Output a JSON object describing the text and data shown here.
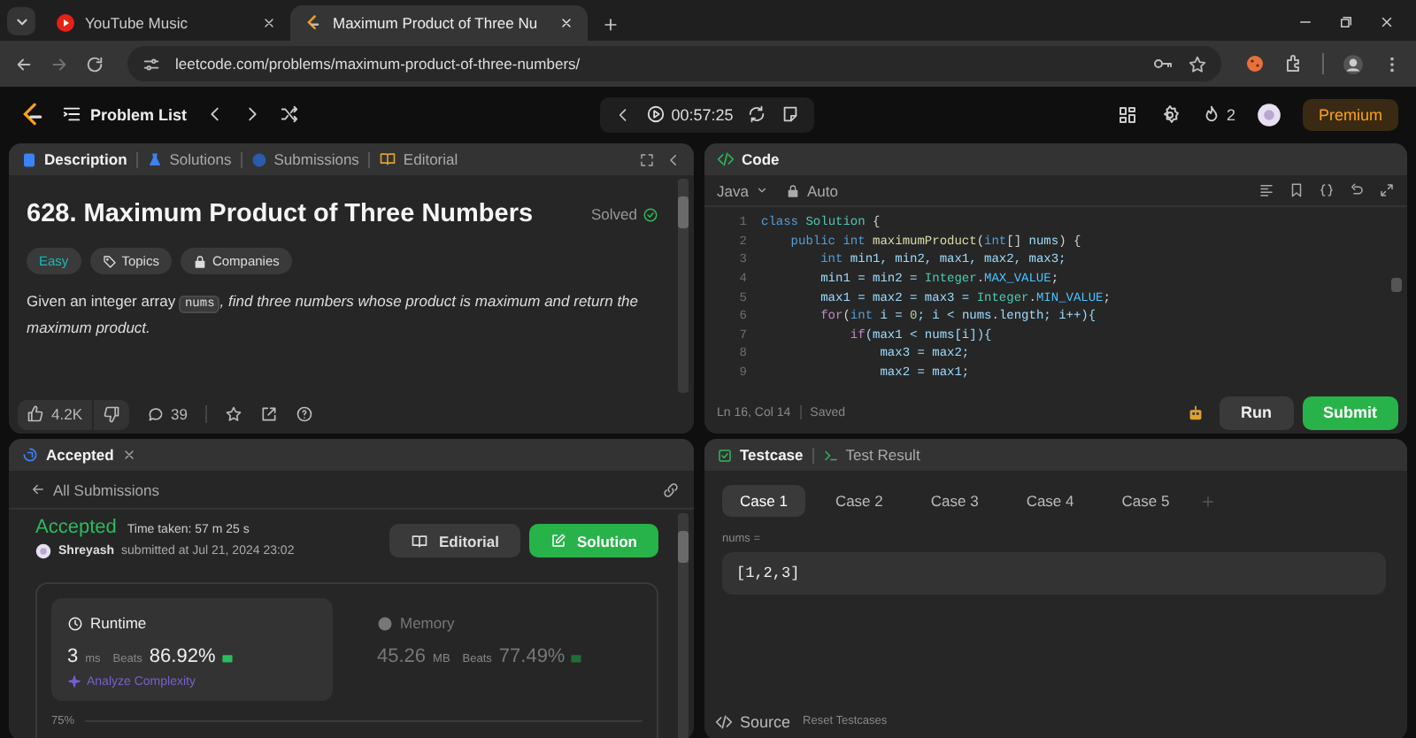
{
  "browser": {
    "tabs": [
      {
        "title": "YouTube Music",
        "selected": false
      },
      {
        "title": "Maximum Product of Three Nu",
        "selected": true
      }
    ],
    "address": "leetcode.com/problems/maximum-product-of-three-numbers/"
  },
  "nav": {
    "problem_list": "Problem List",
    "timer": "00:57:25",
    "streak": "2",
    "premium": "Premium"
  },
  "description": {
    "tabs": [
      {
        "label": "Description",
        "selected": true
      },
      {
        "label": "Solutions",
        "selected": false
      },
      {
        "label": "Submissions",
        "selected": false
      },
      {
        "label": "Editorial",
        "selected": false
      }
    ],
    "title": "628. Maximum Product of Three Numbers",
    "status": "Solved",
    "tags": [
      {
        "label": "Easy",
        "kind": "difficulty"
      },
      {
        "label": "Topics",
        "kind": "topics"
      },
      {
        "label": "Companies",
        "kind": "companies"
      }
    ],
    "statement": {
      "text": "Given an integer array",
      "code": "nums",
      "emphasis": ", find three numbers whose product is maximum and return the maximum product."
    },
    "likes": "4.2K",
    "comments": "39"
  },
  "code": {
    "title": "Code",
    "language": "Java",
    "mode": "Auto",
    "lines": [
      {
        "number": "1",
        "tokens": [
          {
            "text": "class ",
            "kind": "kw"
          },
          {
            "text": "Solution",
            "kind": "type"
          },
          {
            "text": " {",
            "kind": "plain"
          }
        ]
      },
      {
        "number": "2",
        "tokens": [
          {
            "text": "    public int ",
            "kind": "kw"
          },
          {
            "text": "maximumProduct",
            "kind": "fn"
          },
          {
            "text": "(",
            "kind": "plain"
          },
          {
            "text": "int",
            "kind": "kw"
          },
          {
            "text": "[] ",
            "kind": "plain"
          },
          {
            "text": "nums",
            "kind": "var"
          },
          {
            "text": ") {",
            "kind": "plain"
          }
        ]
      },
      {
        "number": "3",
        "tokens": [
          {
            "text": "        int ",
            "kind": "kw"
          },
          {
            "text": "min1, min2, max1, max2, max3;",
            "kind": "var"
          }
        ]
      },
      {
        "number": "4",
        "tokens": [
          {
            "text": "        min1 = min2 = ",
            "kind": "var"
          },
          {
            "text": "Integer",
            "kind": "type"
          },
          {
            "text": ".",
            "kind": "plain"
          },
          {
            "text": "MAX_VALUE",
            "kind": "const"
          },
          {
            "text": ";",
            "kind": "plain"
          }
        ]
      },
      {
        "number": "5",
        "tokens": [
          {
            "text": "        max1 = max2 = max3 = ",
            "kind": "var"
          },
          {
            "text": "Integer",
            "kind": "type"
          },
          {
            "text": ".",
            "kind": "plain"
          },
          {
            "text": "MIN_VALUE",
            "kind": "const"
          },
          {
            "text": ";",
            "kind": "plain"
          }
        ]
      },
      {
        "number": "6",
        "tokens": [
          {
            "text": "        for",
            "kind": "ctl"
          },
          {
            "text": "(",
            "kind": "plain"
          },
          {
            "text": "int",
            "kind": "kw"
          },
          {
            "text": " i = ",
            "kind": "var"
          },
          {
            "text": "0",
            "kind": "num"
          },
          {
            "text": "; i < nums.length; i++){",
            "kind": "var"
          }
        ]
      },
      {
        "number": "7",
        "tokens": [
          {
            "text": "            if",
            "kind": "ctl"
          },
          {
            "text": "(max1 < nums[i]){",
            "kind": "var"
          }
        ]
      },
      {
        "number": "8",
        "tokens": [
          {
            "text": "                max3 = max2;",
            "kind": "var"
          }
        ]
      },
      {
        "number": "9",
        "tokens": [
          {
            "text": "                max2 = max1;",
            "kind": "var"
          }
        ]
      }
    ],
    "cursor": "Ln 16, Col 14",
    "save_state": "Saved",
    "run": "Run",
    "submit": "Submit"
  },
  "result": {
    "tab": "Accepted",
    "back": "All Submissions",
    "verdict": "Accepted",
    "time_taken": "Time taken: 57 m 25 s",
    "user": "Shreyash",
    "submitted": "submitted at Jul 21, 2024 23:02",
    "buttons": [
      {
        "label": "Editorial",
        "kind": "secondary"
      },
      {
        "label": "Solution",
        "kind": "primary"
      }
    ],
    "metrics": [
      {
        "label": "Runtime",
        "value": "3",
        "unit": "ms",
        "beats_label": "Beats",
        "beats": "86.92%",
        "selected": true
      },
      {
        "label": "Memory",
        "value": "45.26",
        "unit": "MB",
        "beats_label": "Beats",
        "beats": "77.49%",
        "selected": false
      }
    ],
    "analyze": "Analyze Complexity",
    "axis_label": "75%"
  },
  "tests": {
    "tabs": [
      {
        "label": "Testcase",
        "selected": true
      },
      {
        "label": "Test Result",
        "selected": false
      }
    ],
    "cases": [
      {
        "label": "Case 1",
        "selected": true
      },
      {
        "label": "Case 2",
        "selected": false
      },
      {
        "label": "Case 3",
        "selected": false
      },
      {
        "label": "Case 4",
        "selected": false
      },
      {
        "label": "Case 5",
        "selected": false
      }
    ],
    "params": [
      {
        "name": "nums =",
        "value": "[1,2,3]"
      }
    ],
    "source": "Source",
    "reset": "Reset Testcases"
  }
}
